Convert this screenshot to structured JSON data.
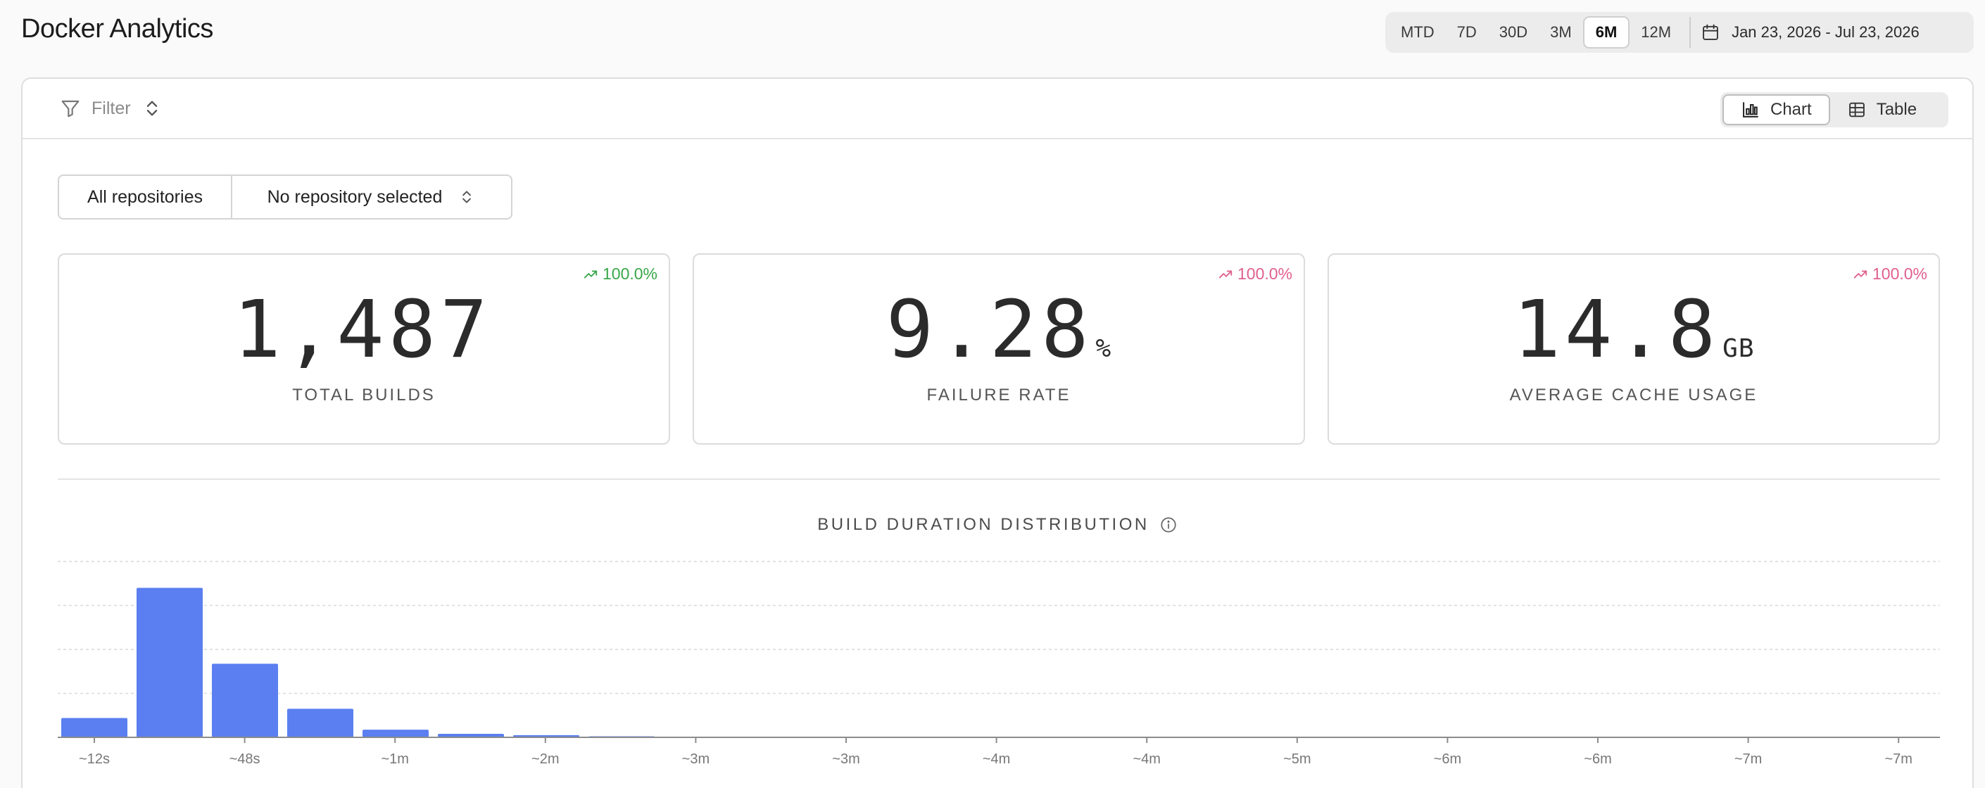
{
  "app": {
    "title": "Docker Analytics"
  },
  "range": {
    "options": [
      "MTD",
      "7D",
      "30D",
      "3M",
      "6M",
      "12M"
    ],
    "selected": "6M",
    "date_range": "Jan 23, 2026 - Jul 23, 2026"
  },
  "toolbar": {
    "filter_label": "Filter",
    "view": {
      "chart_label": "Chart",
      "table_label": "Table",
      "selected": "Chart"
    }
  },
  "repo": {
    "all_label": "All repositories",
    "select_label": "No repository selected"
  },
  "stats": [
    {
      "value": "1,487",
      "unit": "",
      "label": "TOTAL BUILDS",
      "trend": "100.0%",
      "trend_color": "#3aa74a"
    },
    {
      "value": "9.28",
      "unit": "%",
      "label": "FAILURE RATE",
      "trend": "100.0%",
      "trend_color": "#e0608f"
    },
    {
      "value": "14.8",
      "unit": "GB",
      "label": "AVERAGE CACHE USAGE",
      "trend": "100.0%",
      "trend_color": "#e0608f"
    }
  ],
  "chart_title": "BUILD DURATION DISTRIBUTION",
  "chart_data": {
    "type": "bar",
    "title": "BUILD DURATION DISTRIBUTION",
    "tick_labels": [
      "~12s",
      "~48s",
      "~1m",
      "~2m",
      "~3m",
      "~3m",
      "~4m",
      "~4m",
      "~5m",
      "~6m",
      "~6m",
      "~7m",
      "~7m"
    ],
    "values": [
      88,
      680,
      335,
      130,
      35,
      16,
      10,
      5,
      1,
      0,
      3,
      2,
      0,
      1,
      3,
      0,
      0,
      3,
      3,
      3,
      3,
      2,
      1,
      0,
      0,
      0
    ],
    "color": "#5b7ff0",
    "ylim": [
      0,
      800
    ],
    "grid": true
  }
}
